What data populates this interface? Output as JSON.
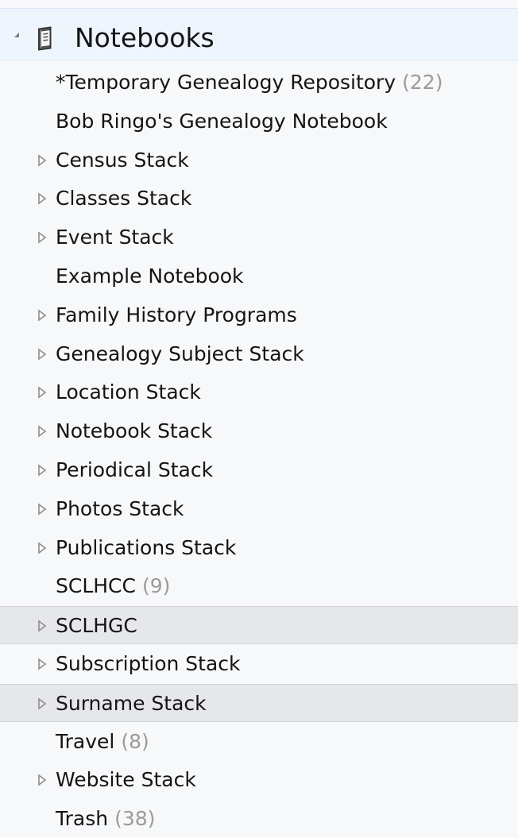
{
  "tree": {
    "root": {
      "label": "Notebooks"
    },
    "items": [
      {
        "label": "*Temporary Genealogy Repository",
        "count": "(22)",
        "has_children": false,
        "selected": false
      },
      {
        "label": "Bob Ringo's Genealogy Notebook",
        "count": "",
        "has_children": false,
        "selected": false
      },
      {
        "label": "Census Stack",
        "count": "",
        "has_children": true,
        "selected": false
      },
      {
        "label": "Classes Stack",
        "count": "",
        "has_children": true,
        "selected": false
      },
      {
        "label": "Event Stack",
        "count": "",
        "has_children": true,
        "selected": false
      },
      {
        "label": "Example Notebook",
        "count": "",
        "has_children": false,
        "selected": false
      },
      {
        "label": "Family History Programs",
        "count": "",
        "has_children": true,
        "selected": false
      },
      {
        "label": "Genealogy Subject Stack",
        "count": "",
        "has_children": true,
        "selected": false
      },
      {
        "label": "Location Stack",
        "count": "",
        "has_children": true,
        "selected": false
      },
      {
        "label": "Notebook Stack",
        "count": "",
        "has_children": true,
        "selected": false
      },
      {
        "label": "Periodical Stack",
        "count": "",
        "has_children": true,
        "selected": false
      },
      {
        "label": "Photos Stack",
        "count": "",
        "has_children": true,
        "selected": false
      },
      {
        "label": "Publications Stack",
        "count": "",
        "has_children": true,
        "selected": false
      },
      {
        "label": "SCLHCC",
        "count": "(9)",
        "has_children": false,
        "selected": false
      },
      {
        "label": "SCLHGC",
        "count": "",
        "has_children": true,
        "selected": true
      },
      {
        "label": "Subscription Stack",
        "count": "",
        "has_children": true,
        "selected": false
      },
      {
        "label": "Surname Stack",
        "count": "",
        "has_children": true,
        "selected": true
      },
      {
        "label": "Travel",
        "count": "(8)",
        "has_children": false,
        "selected": false
      },
      {
        "label": "Website Stack",
        "count": "",
        "has_children": true,
        "selected": false
      },
      {
        "label": "Trash",
        "count": "(38)",
        "has_children": false,
        "selected": false
      }
    ]
  },
  "colors": {
    "background": "#f7f8fa",
    "header_background": "#eef5fd",
    "selected_background": "#e6e7ea",
    "text": "#141414",
    "count_text": "#9a9a9a",
    "expander": "#8e8e8e"
  },
  "icons": {
    "root_expander": "expanded-triangle-icon",
    "root_icon": "notebook-icon",
    "child_expander": "collapsed-triangle-icon"
  }
}
